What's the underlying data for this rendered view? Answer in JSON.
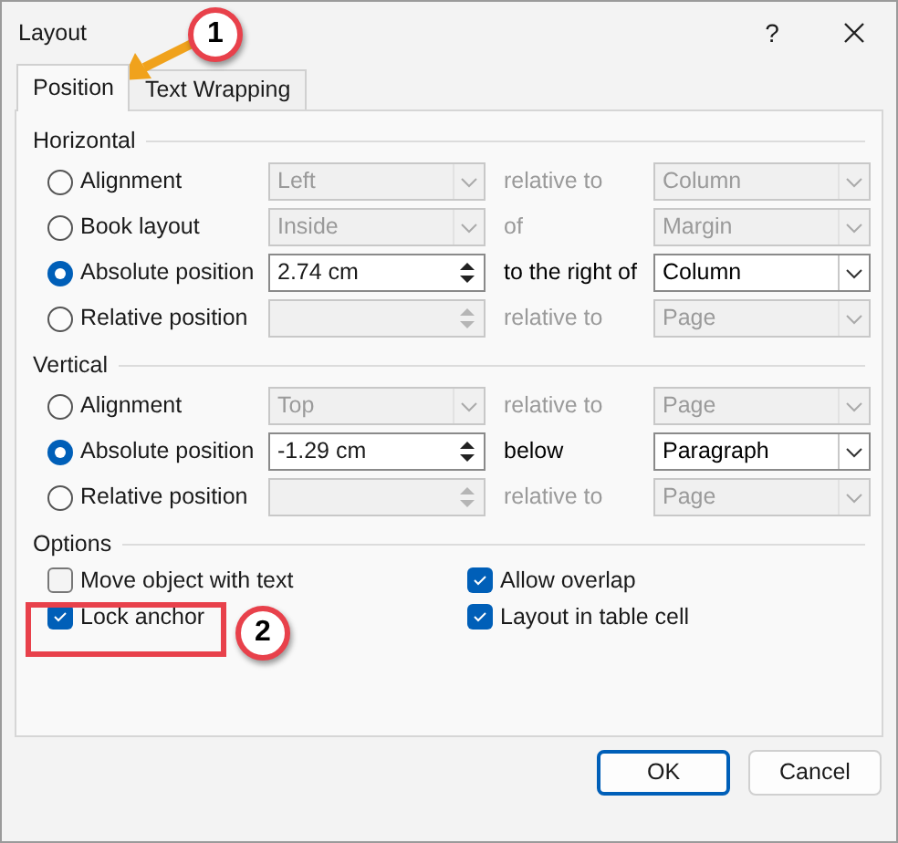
{
  "window": {
    "title": "Layout",
    "help": "?"
  },
  "tabs": [
    {
      "label": "Position",
      "selected": true
    },
    {
      "label": "Text Wrapping",
      "selected": false
    }
  ],
  "sections": [
    {
      "title": "Horizontal",
      "rows": [
        {
          "label": "Alignment",
          "selected": false,
          "field": {
            "kind": "dropdown",
            "value": "Left",
            "disabled": true
          },
          "relation": {
            "text": "relative to",
            "disabled": true
          },
          "target": {
            "value": "Column",
            "disabled": true
          }
        },
        {
          "label": "Book layout",
          "selected": false,
          "field": {
            "kind": "dropdown",
            "value": "Inside",
            "disabled": true
          },
          "relation": {
            "text": "of",
            "disabled": true
          },
          "target": {
            "value": "Margin",
            "disabled": true
          }
        },
        {
          "label": "Absolute position",
          "selected": true,
          "field": {
            "kind": "spinner",
            "value": "2.74 cm",
            "disabled": false
          },
          "relation": {
            "text": "to the right of",
            "disabled": false
          },
          "target": {
            "value": "Column",
            "disabled": false
          }
        },
        {
          "label": "Relative position",
          "selected": false,
          "field": {
            "kind": "spinner",
            "disabled": true
          },
          "relation": {
            "text": "relative to",
            "disabled": true
          },
          "target": {
            "value": "Page",
            "disabled": true
          }
        }
      ]
    },
    {
      "title": "Vertical",
      "rows": [
        {
          "label": "Alignment",
          "selected": false,
          "field": {
            "kind": "dropdown",
            "value": "Top",
            "disabled": true
          },
          "relation": {
            "text": "relative to",
            "disabled": true
          },
          "target": {
            "value": "Page",
            "disabled": true
          }
        },
        {
          "label": "Absolute position",
          "selected": true,
          "field": {
            "kind": "spinner",
            "value": "-1.29 cm",
            "disabled": false
          },
          "relation": {
            "text": "below",
            "disabled": false
          },
          "target": {
            "value": "Paragraph",
            "disabled": false
          }
        },
        {
          "label": "Relative position",
          "selected": false,
          "field": {
            "kind": "spinner",
            "disabled": true
          },
          "relation": {
            "text": "relative to",
            "disabled": true
          },
          "target": {
            "value": "Page",
            "disabled": true
          }
        }
      ]
    }
  ],
  "options": {
    "title": "Options",
    "columns": [
      [
        {
          "label": "Move object with text",
          "checked": false
        },
        {
          "label": "Lock anchor",
          "checked": true
        }
      ],
      [
        {
          "label": "Allow overlap",
          "checked": true
        },
        {
          "label": "Layout in table cell",
          "checked": true
        }
      ]
    ]
  },
  "buttons": [
    {
      "label": "OK",
      "default": true
    },
    {
      "label": "Cancel",
      "default": false
    }
  ],
  "annotations": [
    {
      "label": "1"
    },
    {
      "label": "2"
    }
  ]
}
